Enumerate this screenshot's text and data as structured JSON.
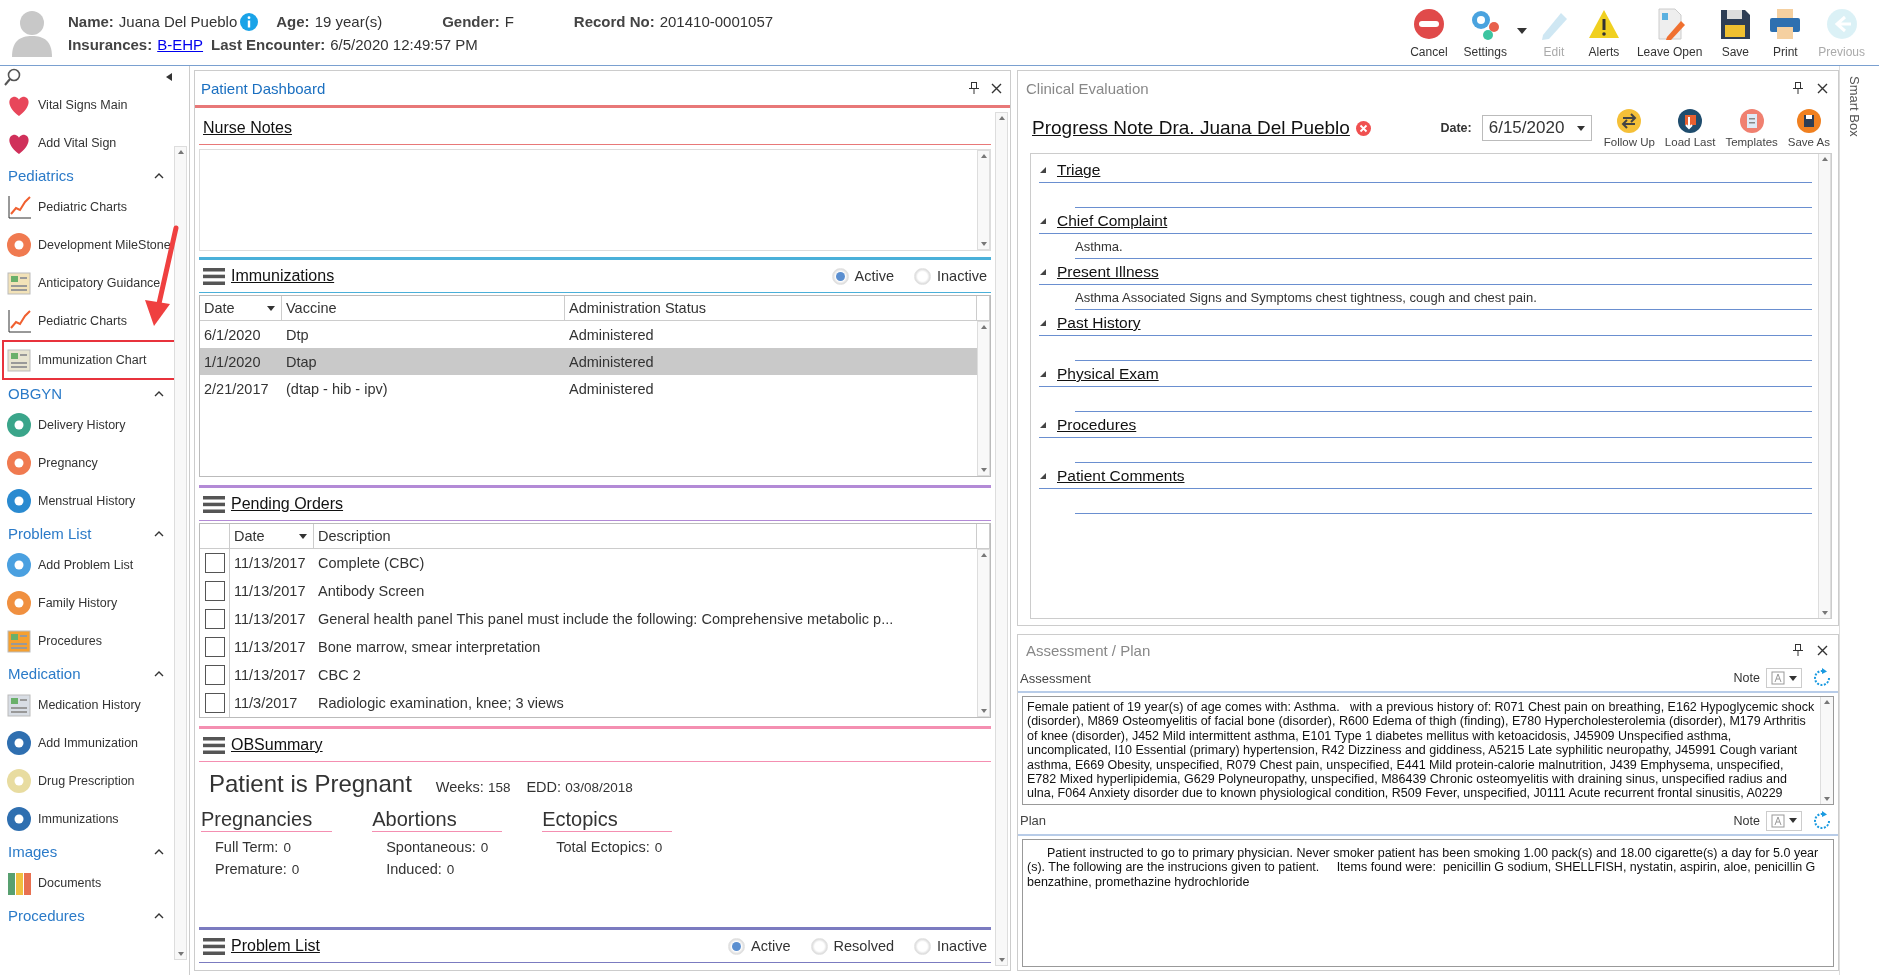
{
  "header": {
    "name_label": "Name:",
    "name": "Juana Del Pueblo",
    "age_label": "Age:",
    "age": "19 year(s)",
    "gender_label": "Gender:",
    "gender": "F",
    "record_label": "Record No:",
    "record": "201410-0001057",
    "insurance_label": "Insurances:",
    "insurance": "B-EHP",
    "encounter_label": "Last Encounter:",
    "encounter": "6/5/2020 12:49:57 PM"
  },
  "toolbar": [
    {
      "label": "Cancel",
      "disabled": false,
      "dropdown": false
    },
    {
      "label": "Settings",
      "disabled": false,
      "dropdown": true
    },
    {
      "label": "Edit",
      "disabled": true,
      "dropdown": false
    },
    {
      "label": "Alerts",
      "disabled": false,
      "dropdown": false
    },
    {
      "label": "Leave Open",
      "disabled": false,
      "dropdown": false
    },
    {
      "label": "Save",
      "disabled": false,
      "dropdown": false
    },
    {
      "label": "Print",
      "disabled": false,
      "dropdown": false
    },
    {
      "label": "Previous",
      "disabled": true,
      "dropdown": false
    }
  ],
  "sidebar": {
    "items": [
      {
        "label": "Vital Signs Main",
        "selected": false
      },
      {
        "label": "Add Vital Sign",
        "selected": false
      }
    ],
    "sections": [
      {
        "title": "Pediatrics",
        "expanded": true,
        "items": [
          {
            "label": "Pediatric Charts",
            "selected": false
          },
          {
            "label": "Development MileStone",
            "selected": false
          },
          {
            "label": "Anticipatory Guidance",
            "selected": false
          },
          {
            "label": "Pediatric Charts",
            "selected": false
          },
          {
            "label": "Immunization Chart",
            "selected": true
          }
        ]
      },
      {
        "title": "OBGYN",
        "expanded": true,
        "items": [
          {
            "label": "Delivery History",
            "selected": false
          },
          {
            "label": "Pregnancy",
            "selected": false
          },
          {
            "label": "Menstrual History",
            "selected": false
          }
        ]
      },
      {
        "title": "Problem List",
        "expanded": true,
        "items": [
          {
            "label": "Add Problem List",
            "selected": false
          },
          {
            "label": "Family History",
            "selected": false
          },
          {
            "label": "Procedures",
            "selected": false
          }
        ]
      },
      {
        "title": "Medication",
        "expanded": true,
        "items": [
          {
            "label": "Medication History",
            "selected": false
          },
          {
            "label": "Add Immunization",
            "selected": false
          },
          {
            "label": "Drug Prescription",
            "selected": false
          },
          {
            "label": "Immunizations",
            "selected": false
          }
        ]
      },
      {
        "title": "Images",
        "expanded": true,
        "items": [
          {
            "label": "Documents",
            "selected": false
          }
        ]
      },
      {
        "title": "Procedures",
        "expanded": true
      }
    ]
  },
  "dashboard": {
    "title": "Patient Dashboard",
    "nurse_notes": {
      "title": "Nurse Notes"
    },
    "immunizations": {
      "title": "Immunizations",
      "filters": [
        {
          "label": "Active",
          "selected": true
        },
        {
          "label": "Inactive",
          "selected": false
        }
      ],
      "columns": [
        "Date",
        "Vaccine",
        "Administration Status"
      ],
      "rows": [
        {
          "cells": [
            "6/1/2020",
            "Dtp",
            "Administered"
          ],
          "selected": false
        },
        {
          "cells": [
            "1/1/2020",
            "Dtap",
            "Administered"
          ],
          "selected": true
        },
        {
          "cells": [
            "2/21/2017",
            "(dtap - hib - ipv)",
            "Administered"
          ],
          "selected": false
        }
      ]
    },
    "pending_orders": {
      "title": "Pending Orders",
      "columns": [
        "Date",
        "Description"
      ],
      "rows": [
        {
          "checked": false,
          "cells": [
            "11/13/2017",
            "Complete (CBC)"
          ]
        },
        {
          "checked": false,
          "cells": [
            "11/13/2017",
            "Antibody Screen"
          ]
        },
        {
          "checked": false,
          "cells": [
            "11/13/2017",
            "General health panel This panel must include the following: Comprehensive metabolic p..."
          ]
        },
        {
          "checked": false,
          "cells": [
            "11/13/2017",
            "Bone marrow, smear interpretation"
          ]
        },
        {
          "checked": false,
          "cells": [
            "11/13/2017",
            "CBC 2"
          ]
        },
        {
          "checked": false,
          "cells": [
            "11/3/2017",
            "Radiologic examination, knee; 3 views"
          ]
        }
      ]
    },
    "ob_summary": {
      "title": "OBSummary",
      "status": "Patient is Pregnant",
      "weeks_label": "Weeks:",
      "weeks": "158",
      "edd_label": "EDD:",
      "edd": "03/08/2018",
      "groups": [
        {
          "title": "Pregnancies",
          "items": [
            {
              "label": "Full Term:",
              "value": "0"
            },
            {
              "label": "Premature:",
              "value": "0"
            }
          ]
        },
        {
          "title": "Abortions",
          "items": [
            {
              "label": "Spontaneous:",
              "value": "0"
            },
            {
              "label": "Induced:",
              "value": "0"
            }
          ]
        },
        {
          "title": "Ectopics",
          "items": [
            {
              "label": "Total Ectopics:",
              "value": "0"
            }
          ]
        }
      ]
    },
    "problem_list": {
      "title": "Problem List",
      "filters": [
        {
          "label": "Active",
          "selected": true
        },
        {
          "label": "Resolved",
          "selected": false
        },
        {
          "label": "Inactive",
          "selected": false
        }
      ]
    }
  },
  "clinical_evaluation": {
    "title": "Clinical Evaluation",
    "note_title": "Progress Note Dra. Juana Del Pueblo",
    "date_label": "Date:",
    "date": "6/15/2020",
    "actions": [
      "Follow Up",
      "Load Last",
      "Templates",
      "Save As"
    ],
    "sections": [
      {
        "title": "Triage",
        "expanded": true
      },
      {
        "title": "Chief Complaint",
        "expanded": true,
        "text": "Asthma."
      },
      {
        "title": "Present Illness",
        "expanded": true,
        "text": "Asthma Associated Signs and Symptoms chest tightness, cough and chest pain."
      },
      {
        "title": "Past History",
        "expanded": true
      },
      {
        "title": "Physical Exam",
        "expanded": true
      },
      {
        "title": "Procedures",
        "expanded": true
      },
      {
        "title": "Patient Comments",
        "expanded": true
      }
    ]
  },
  "assessment_plan": {
    "title": "Assessment / Plan",
    "assessment": {
      "label": "Assessment",
      "note_label": "Note",
      "text": "Female patient of 19 year(s) of age comes with: Asthma.   with a previous history of: R071 Chest pain on breathing, E162 Hypoglycemic shock (disorder), M869 Osteomyelitis of facial bone (disorder), R600 Edema of thigh (finding), E780 Hypercholesterolemia (disorder), M179 Arthritis of knee (disorder), J452 Mild intermittent asthma, E101 Type 1 diabetes mellitus with ketoacidosis, J45909 Unspecified asthma, uncomplicated, I10 Essential (primary) hypertension, R42 Dizziness and giddiness, A5215 Late syphilitic neuropathy, J45991 Cough variant asthma, E669 Obesity, unspecified, R079 Chest pain, unspecified, E441 Mild protein-calorie malnutrition, J439 Emphysema, unspecified, E782 Mixed hyperlipidemia, G629 Polyneuropathy, unspecified, M86439 Chronic osteomyelitis with draining sinus, unspecified radius and ulna, F064 Anxiety disorder due to known physiological condition, R509 Fever, unspecified, J0111 Acute recurrent frontal sinusitis, A0229"
    },
    "plan": {
      "label": "Plan",
      "note_label": "Note",
      "text": "Patient instructed to go to primary physician. Never smoker patient has been smoking 1.00 pack(s) and 18.00 cigarette(s) a day for 5.0 year (s). The following are the instrucions given to patient.     Items found were:  penicillin G sodium, SHELLFISH, nystatin, aspirin, aloe, penicillin G benzathine, promethazine hydrochloride"
    }
  },
  "smart_box": {
    "title": "Smart Box"
  }
}
